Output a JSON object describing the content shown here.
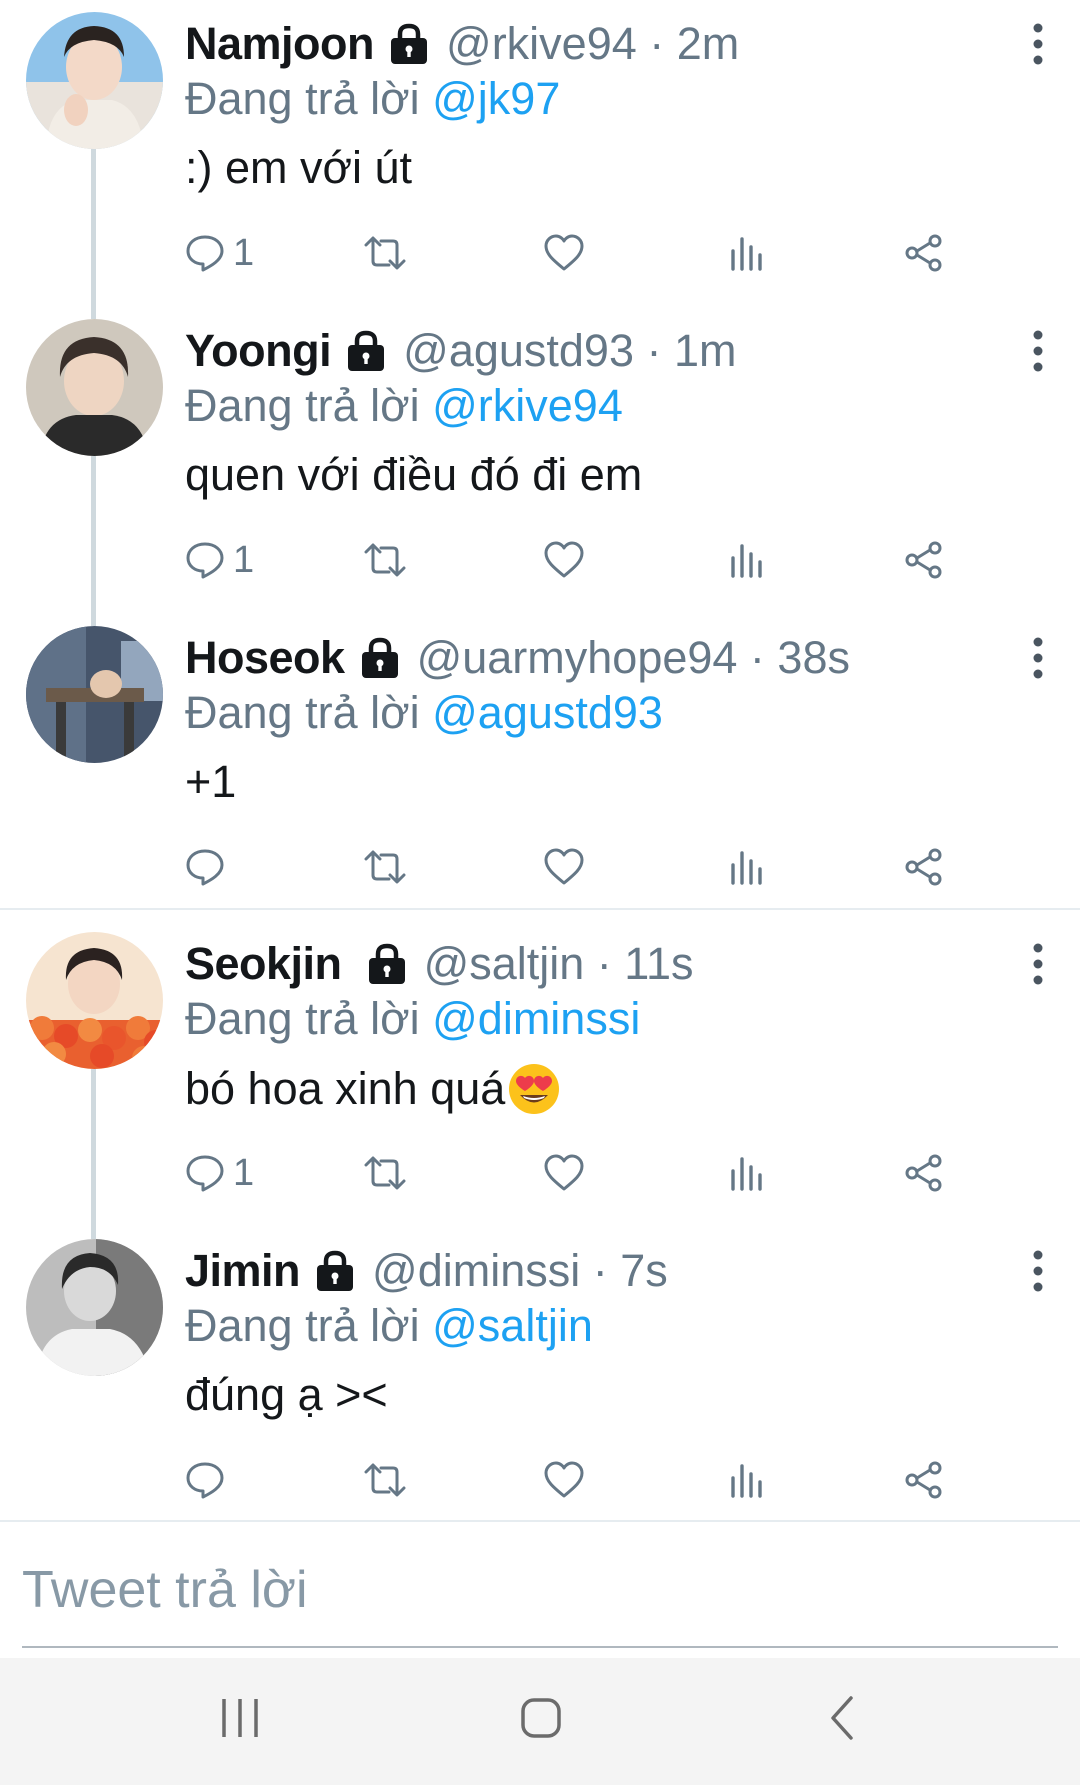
{
  "tweets": [
    {
      "name": "Namjoon",
      "meta": "@rkive94 · 2m",
      "reply_prefix": "Đang trả lời ",
      "reply_to": "@jk97",
      "text": ":) em với út",
      "reply_count": "1",
      "avatar_icon": "avatar-photo"
    },
    {
      "name": "Yoongi",
      "meta": "@agustd93 · 1m",
      "reply_prefix": "Đang trả lời ",
      "reply_to": "@rkive94",
      "text": "quen với điều đó đi em",
      "reply_count": "1",
      "avatar_icon": "avatar-photo"
    },
    {
      "name": "Hoseok",
      "meta": "@uarmyhope94 · 38s",
      "reply_prefix": "Đang trả lời ",
      "reply_to": "@agustd93",
      "text": "+1",
      "reply_count": "",
      "avatar_icon": "avatar-photo"
    },
    {
      "name": "Seokjin",
      "meta": "@saltjin · 11s",
      "reply_prefix": "Đang trả lời ",
      "reply_to": "@diminssi",
      "text": "bó hoa xinh quá",
      "emoji": "heart-eyes-emoji",
      "reply_count": "1",
      "avatar_icon": "avatar-photo"
    },
    {
      "name": "Jimin",
      "meta": "@diminssi · 7s",
      "reply_prefix": "Đang trả lời ",
      "reply_to": "@saltjin",
      "text": "đúng ạ ><",
      "reply_count": "",
      "avatar_icon": "avatar-photo"
    }
  ],
  "compose": {
    "placeholder": "Tweet trả lời"
  },
  "navbar": {
    "buttons": [
      "recent-apps-icon",
      "home-icon",
      "back-icon"
    ]
  },
  "colors": {
    "text": "#14171a",
    "secondary": "#657786",
    "mention": "#1da1f2",
    "thread_line": "#cfd9de",
    "divider": "#e6ecf0",
    "navbar_bg": "#f4f4f4"
  }
}
